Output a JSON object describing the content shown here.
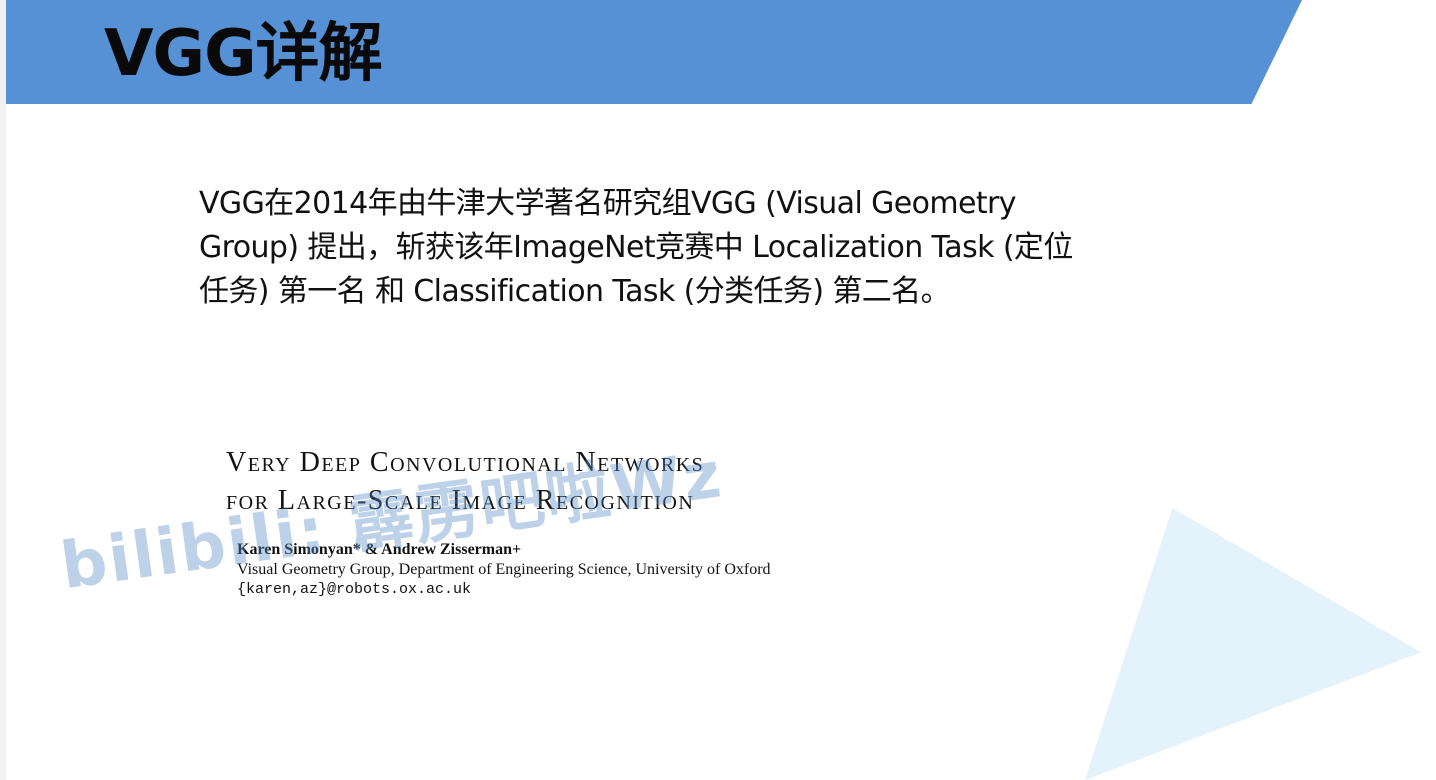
{
  "slide": {
    "title": "VGG详解",
    "intro_lines": [
      "VGG在2014年由牛津大学著名研究组VGG (Visual Geometry",
      "Group) 提出，斩获该年ImageNet竞赛中 Localization Task (定位",
      "任务) 第一名 和 Classification Task (分类任务) 第二名。"
    ]
  },
  "paper": {
    "title_lines": [
      "Very Deep Convolutional Networks",
      "for Large-Scale Image Recognition"
    ],
    "authors": "Karen Simonyan* & Andrew Zisserman+",
    "affiliation": "Visual Geometry Group, Department of Engineering Science, University of Oxford",
    "email": "{karen,az}@robots.ox.ac.uk"
  },
  "watermark": "bilibili: 霹雳吧啦Wz",
  "colors": {
    "header": "#5591d4",
    "triangle": "#e4f2fb",
    "watermark": "#5a8cc8"
  }
}
